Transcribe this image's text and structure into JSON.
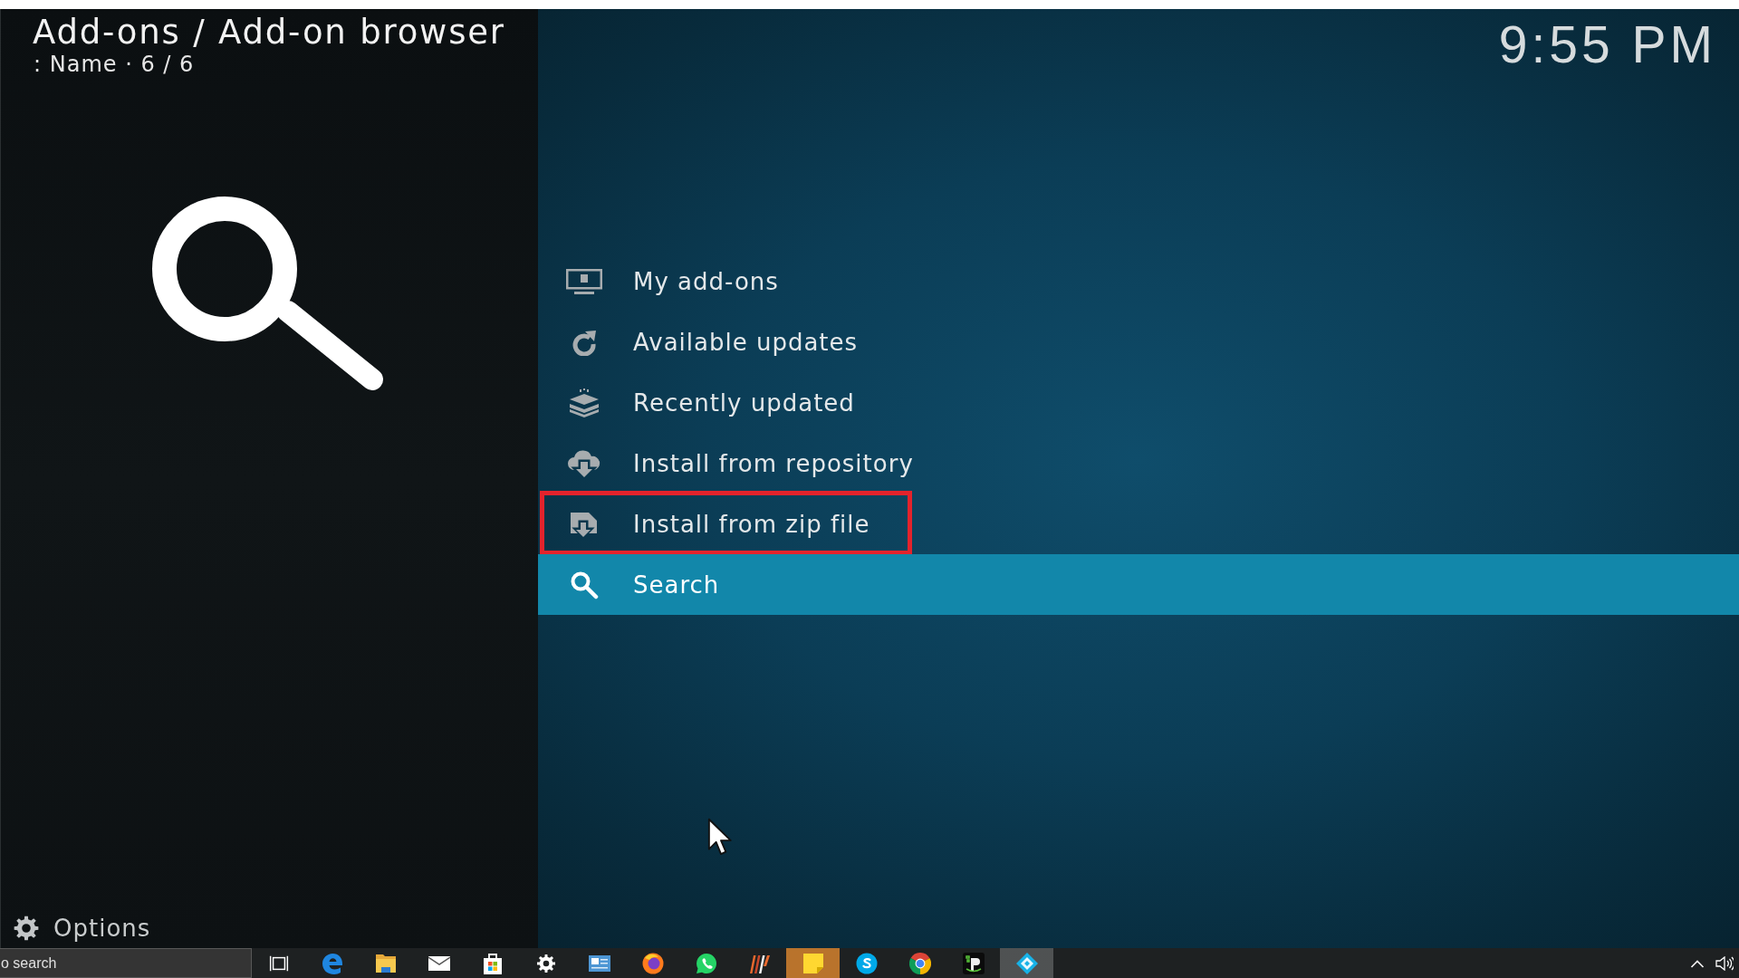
{
  "header": {
    "breadcrumb": "Add-ons / Add-on browser",
    "sort_info": ": Name · 6 / 6"
  },
  "clock": "9:55 PM",
  "menu": {
    "items": [
      {
        "label": "My add-ons",
        "selected": false,
        "annotated": false
      },
      {
        "label": "Available updates",
        "selected": false,
        "annotated": false
      },
      {
        "label": "Recently updated",
        "selected": false,
        "annotated": false
      },
      {
        "label": "Install from repository",
        "selected": false,
        "annotated": false
      },
      {
        "label": "Install from zip file",
        "selected": false,
        "annotated": true
      },
      {
        "label": "Search",
        "selected": true,
        "annotated": false
      }
    ]
  },
  "options": {
    "label": "Options"
  },
  "taskbar": {
    "search": {
      "placeholder": "o search"
    },
    "apps": [
      {
        "active": false,
        "flashing": false
      },
      {
        "active": false,
        "flashing": false
      },
      {
        "active": false,
        "flashing": false
      },
      {
        "active": false,
        "flashing": false
      },
      {
        "active": false,
        "flashing": false
      },
      {
        "active": false,
        "flashing": false
      },
      {
        "active": false,
        "flashing": false
      },
      {
        "active": false,
        "flashing": false
      },
      {
        "active": false,
        "flashing": false
      },
      {
        "active": false,
        "flashing": false
      },
      {
        "active": false,
        "flashing": true
      },
      {
        "active": false,
        "flashing": false
      },
      {
        "active": false,
        "flashing": false
      },
      {
        "active": false,
        "flashing": false
      },
      {
        "active": true,
        "flashing": false
      }
    ]
  }
}
